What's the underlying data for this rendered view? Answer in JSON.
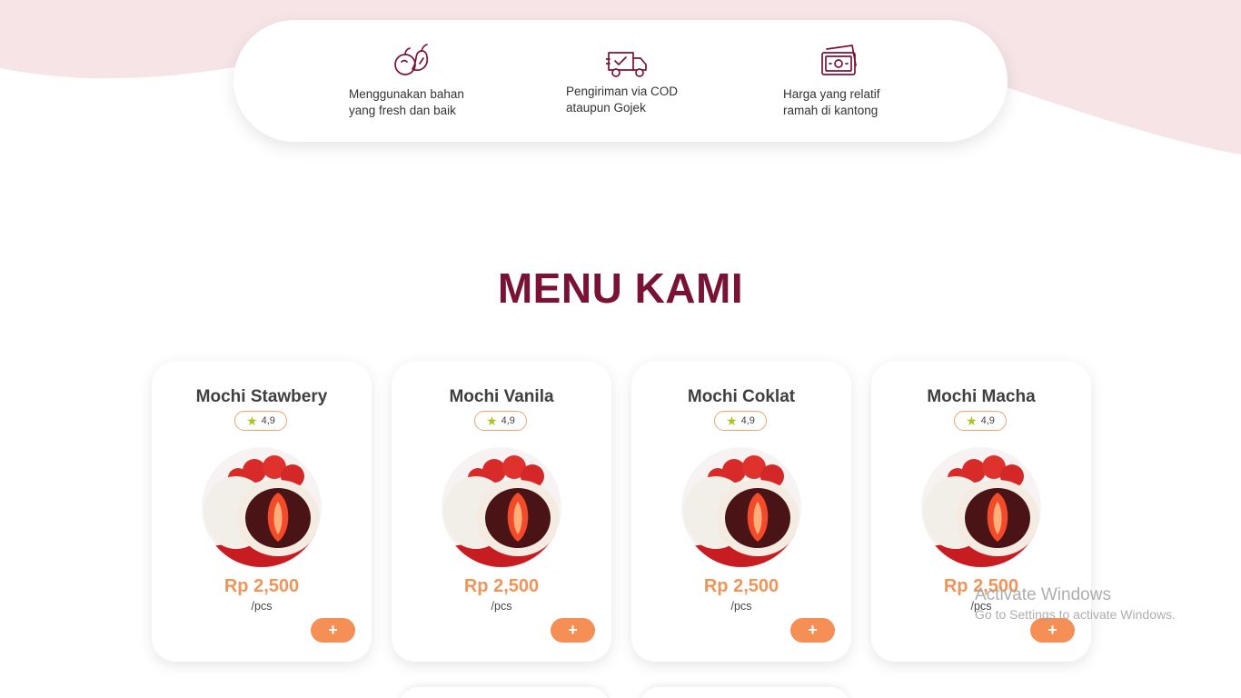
{
  "colors": {
    "brand": "#7a1236",
    "accent": "#f58f55",
    "price": "#f0955a",
    "wave": "#f6e4e6",
    "star": "#a6c81e"
  },
  "features": [
    {
      "icon": "fruit-icon",
      "text": "Menggunakan bahan\nyang fresh dan baik"
    },
    {
      "icon": "delivery-truck-icon",
      "text": "Pengiriman via COD\nataupun Gojek"
    },
    {
      "icon": "money-icon",
      "text": "Harga yang relatif\nramah di kantong"
    }
  ],
  "menu": {
    "title": "MENU KAMI",
    "products": [
      {
        "name": "Mochi Stawbery",
        "rating": "4,9",
        "price": "Rp 2,500",
        "unit": "/pcs",
        "add_label": "+"
      },
      {
        "name": "Mochi Vanila",
        "rating": "4,9",
        "price": "Rp 2,500",
        "unit": "/pcs",
        "add_label": "+"
      },
      {
        "name": "Mochi Coklat",
        "rating": "4,9",
        "price": "Rp 2,500",
        "unit": "/pcs",
        "add_label": "+"
      },
      {
        "name": "Mochi Macha",
        "rating": "4,9",
        "price": "Rp 2,500",
        "unit": "/pcs",
        "add_label": "+"
      }
    ]
  },
  "watermark": {
    "line1": "Activate Windows",
    "line2": "Go to Settings to activate Windows."
  }
}
